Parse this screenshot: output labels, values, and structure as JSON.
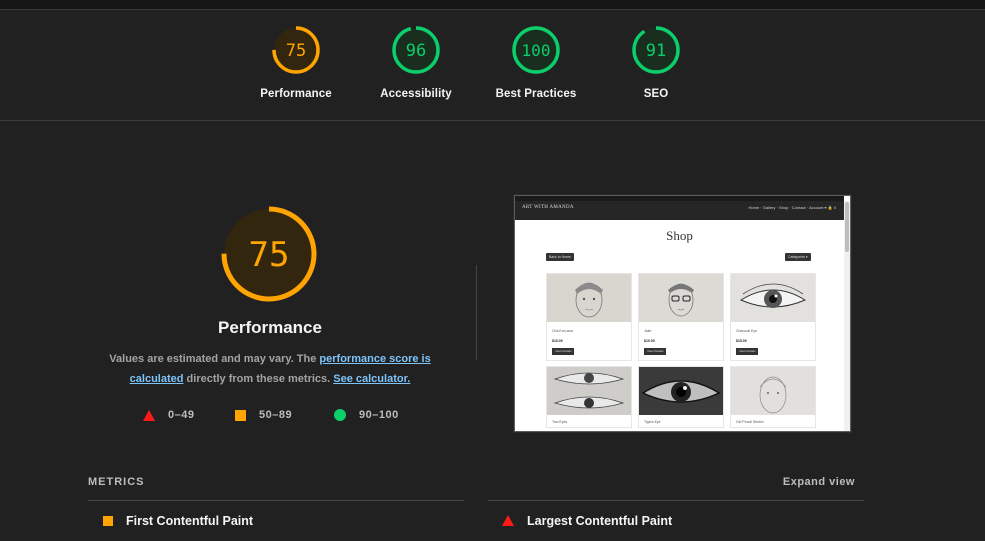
{
  "gauges": [
    {
      "score": "75",
      "label": "Performance",
      "value": 75,
      "color": "#ffa400",
      "fill": "#33260f"
    },
    {
      "score": "96",
      "label": "Accessibility",
      "value": 96,
      "color": "#0cce6b",
      "fill": "#1a2e20"
    },
    {
      "score": "100",
      "label": "Best Practices",
      "value": 100,
      "color": "#0cce6b",
      "fill": "#1a2e20"
    },
    {
      "score": "91",
      "label": "SEO",
      "value": 91,
      "color": "#0cce6b",
      "fill": "#1a2e20"
    }
  ],
  "performance": {
    "score": "75",
    "value": 75,
    "title": "Performance",
    "note_1": "Values are estimated and may vary. The ",
    "note_link_1": "performance score is calculated",
    "note_2": " directly from these metrics. ",
    "note_link_2": "See calculator."
  },
  "legend": {
    "fail": "0–49",
    "average": "50–89",
    "pass": "90–100"
  },
  "screenshot": {
    "brand": "ART WITH AMANDA",
    "nav": "Home · Gallery · Shop · Contact · Account ▾  🔒 0",
    "title": "Shop",
    "back_button": "Back to Home",
    "categories_button": "Categories ▾",
    "products": [
      {
        "name": "Cha Eun-woo",
        "price": "$10.00",
        "button": "View Details"
      },
      {
        "name": "Jake",
        "price": "$10.00",
        "button": "View Details"
      },
      {
        "name": "Charcoal Eye",
        "price": "$15.00",
        "button": "View Details"
      },
      {
        "name": "Two Eyes"
      },
      {
        "name": "Tigers Eye"
      },
      {
        "name": "Girl Pencil Sketch"
      }
    ]
  },
  "metrics": {
    "header": "METRICS",
    "expand": "Expand view",
    "fcp": "First Contentful Paint",
    "lcp": "Largest Contentful Paint"
  },
  "colors": {
    "fail": "#ff1a1a",
    "average": "#ffa400",
    "pass": "#0cce6b",
    "link": "#7cc4fa"
  }
}
